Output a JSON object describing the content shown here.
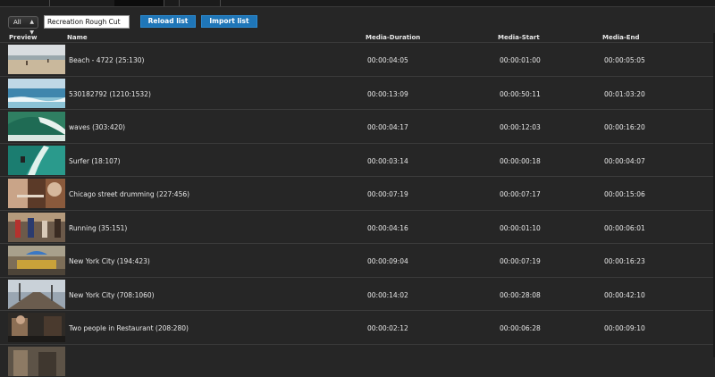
{
  "controls": {
    "filter_value": "All",
    "title_value": "Recreation Rough Cut",
    "reload_label": "Reload list",
    "import_label": "Import list"
  },
  "columns": {
    "preview": "Preview",
    "name": "Name",
    "duration": "Media-Duration",
    "start": "Media-Start",
    "end": "Media-End"
  },
  "clips": [
    {
      "name": "Beach - 4722 (25:130)",
      "duration": "00:00:04:05",
      "start": "00:00:01:00",
      "end": "00:00:05:05"
    },
    {
      "name": "530182792 (1210:1532)",
      "duration": "00:00:13:09",
      "start": "00:00:50:11",
      "end": "00:01:03:20"
    },
    {
      "name": "waves (303:420)",
      "duration": "00:00:04:17",
      "start": "00:00:12:03",
      "end": "00:00:16:20"
    },
    {
      "name": "Surfer (18:107)",
      "duration": "00:00:03:14",
      "start": "00:00:00:18",
      "end": "00:00:04:07"
    },
    {
      "name": "Chicago street drumming (227:456)",
      "duration": "00:00:07:19",
      "start": "00:00:07:17",
      "end": "00:00:15:06"
    },
    {
      "name": "Running (35:151)",
      "duration": "00:00:04:16",
      "start": "00:00:01:10",
      "end": "00:00:06:01"
    },
    {
      "name": "New York City (194:423)",
      "duration": "00:00:09:04",
      "start": "00:00:07:19",
      "end": "00:00:16:23"
    },
    {
      "name": "New York City (708:1060)",
      "duration": "00:00:14:02",
      "start": "00:00:28:08",
      "end": "00:00:42:10"
    },
    {
      "name": "Two people in Restaurant (208:280)",
      "duration": "00:00:02:12",
      "start": "00:00:06:28",
      "end": "00:00:09:10"
    },
    {
      "name": "",
      "duration": "",
      "start": "",
      "end": ""
    }
  ]
}
